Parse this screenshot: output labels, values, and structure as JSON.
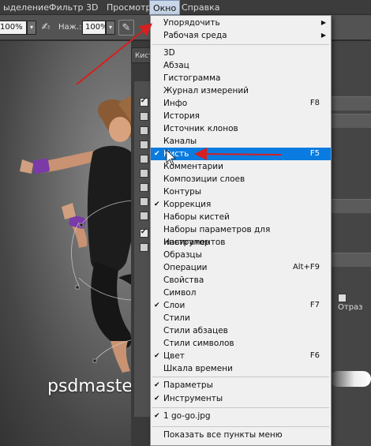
{
  "menubar": {
    "items": [
      "ыделение",
      "Фильтр",
      "3D",
      "Просмотр",
      "Окно",
      "Справка"
    ],
    "active": "Окно"
  },
  "options_bar": {
    "opacity_value": "100%",
    "pressure_label": "Наж.:",
    "pressure_value": "100%"
  },
  "panel": {
    "tab_label": "Кист",
    "reflect_label": "Отраз"
  },
  "watermark": "psdmaster.ru",
  "window_menu": {
    "top": [
      {
        "label": "Упорядочить",
        "submenu": true
      },
      {
        "label": "Рабочая среда",
        "submenu": true
      }
    ],
    "panels": [
      {
        "label": "3D"
      },
      {
        "label": "Абзац"
      },
      {
        "label": "Гистограмма"
      },
      {
        "label": "Журнал измерений"
      },
      {
        "label": "Инфо",
        "shortcut": "F8"
      },
      {
        "label": "История"
      },
      {
        "label": "Источник клонов"
      },
      {
        "label": "Каналы"
      },
      {
        "label": "Кисть",
        "shortcut": "F5",
        "checked": true,
        "highlighted": true
      },
      {
        "label": "Комментарии"
      },
      {
        "label": "Композиции слоев"
      },
      {
        "label": "Контуры"
      },
      {
        "label": "Коррекция",
        "checked": true
      },
      {
        "label": "Наборы кистей"
      },
      {
        "label": "Наборы параметров для инструментов"
      },
      {
        "label": "Навигатор"
      },
      {
        "label": "Образцы"
      },
      {
        "label": "Операции",
        "shortcut": "Alt+F9"
      },
      {
        "label": "Свойства"
      },
      {
        "label": "Символ"
      },
      {
        "label": "Слои",
        "shortcut": "F7",
        "checked": true
      },
      {
        "label": "Стили"
      },
      {
        "label": "Стили абзацев"
      },
      {
        "label": "Стили символов"
      },
      {
        "label": "Цвет",
        "shortcut": "F6",
        "checked": true
      },
      {
        "label": "Шкала времени"
      }
    ],
    "tools": [
      {
        "label": "Параметры",
        "checked": true
      },
      {
        "label": "Инструменты",
        "checked": true
      }
    ],
    "documents": [
      {
        "label": "1 go-go.jpg",
        "checked": true
      }
    ],
    "footer": {
      "label": "Показать все пункты меню"
    }
  },
  "colors": {
    "highlight": "#0a7be0",
    "arrow": "#d42020"
  },
  "icons": [
    "brush-pressure-icon",
    "airbrush-icon",
    "dropdown-arrow-icon",
    "checkmark-icon",
    "submenu-arrow-icon"
  ]
}
